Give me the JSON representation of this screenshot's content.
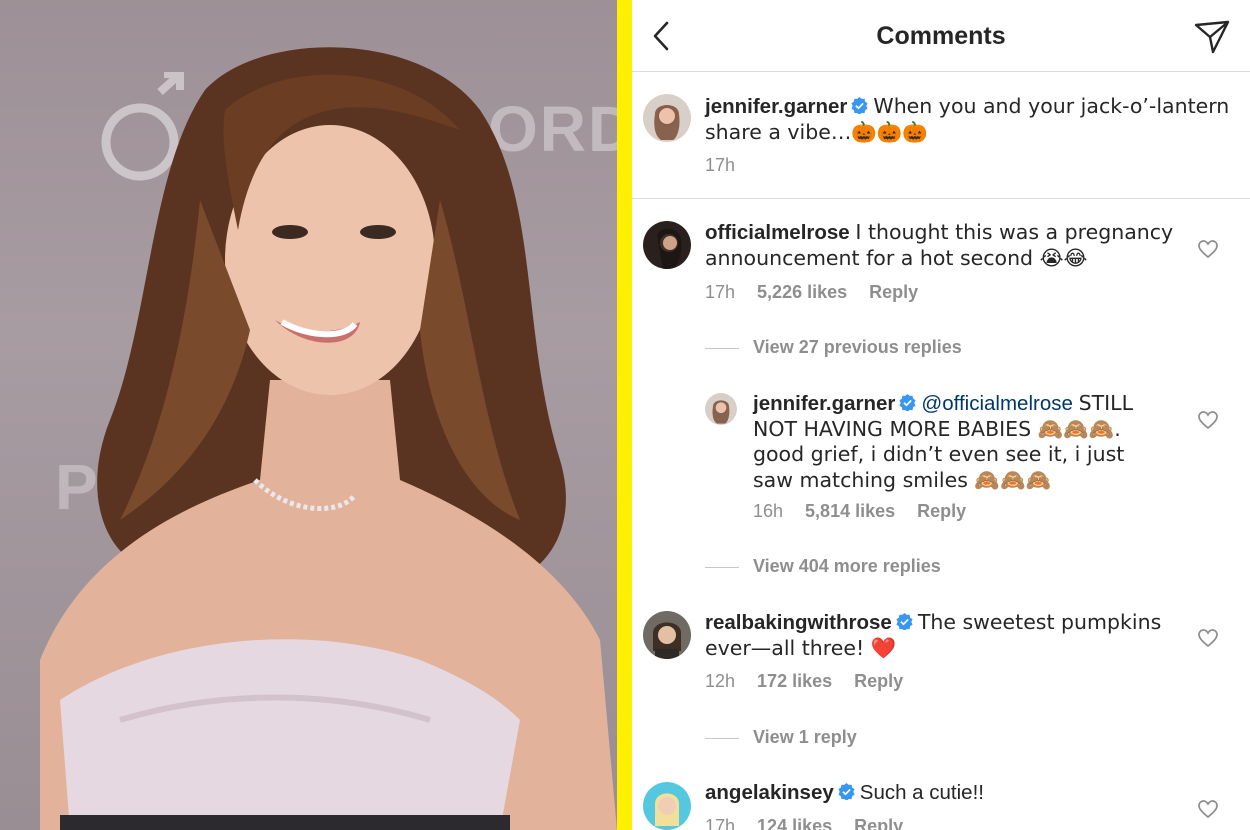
{
  "photo": {
    "bg_text_right": "ORDST",
    "bg_text_left": "PR"
  },
  "header": {
    "title": "Comments"
  },
  "caption": {
    "user": "jennifer.garner",
    "text": "When you and your jack-o’-lantern share a vibe…🎃🎃🎃",
    "time": "17h"
  },
  "comments": [
    {
      "user": "officialmelrose",
      "text": "I thought this was a pregnancy announcement for a hot second 😭😂",
      "time": "17h",
      "likes": "5,226 likes",
      "reply": "Reply",
      "view_replies": "View 27 previous replies"
    },
    {
      "user": "jennifer.garner",
      "mention": "@officialmelrose",
      "text": "STILL NOT HAVING MORE BABIES 🙈🙈🙈. good grief, i didn’t even see it, i just saw matching smiles 🙈🙈🙈",
      "time": "16h",
      "likes": "5,814 likes",
      "reply": "Reply",
      "view_replies": "View 404 more replies"
    },
    {
      "user": "realbakingwithrose",
      "text": "The sweetest pumpkins ever—all three! ❤️",
      "time": "12h",
      "likes": "172 likes",
      "reply": "Reply",
      "view_replies": "View 1 reply"
    },
    {
      "user": "angelakinsey",
      "text": "Such a cutie!!",
      "time": "17h",
      "likes": "124 likes",
      "reply": "Reply"
    }
  ],
  "colors": {
    "divider": "#ffef00",
    "verified": "#3897f0",
    "mention": "#00376b",
    "muted": "#8e8e8e"
  },
  "icons": [
    "back-icon",
    "send-icon",
    "verified-icon",
    "heart-icon"
  ]
}
